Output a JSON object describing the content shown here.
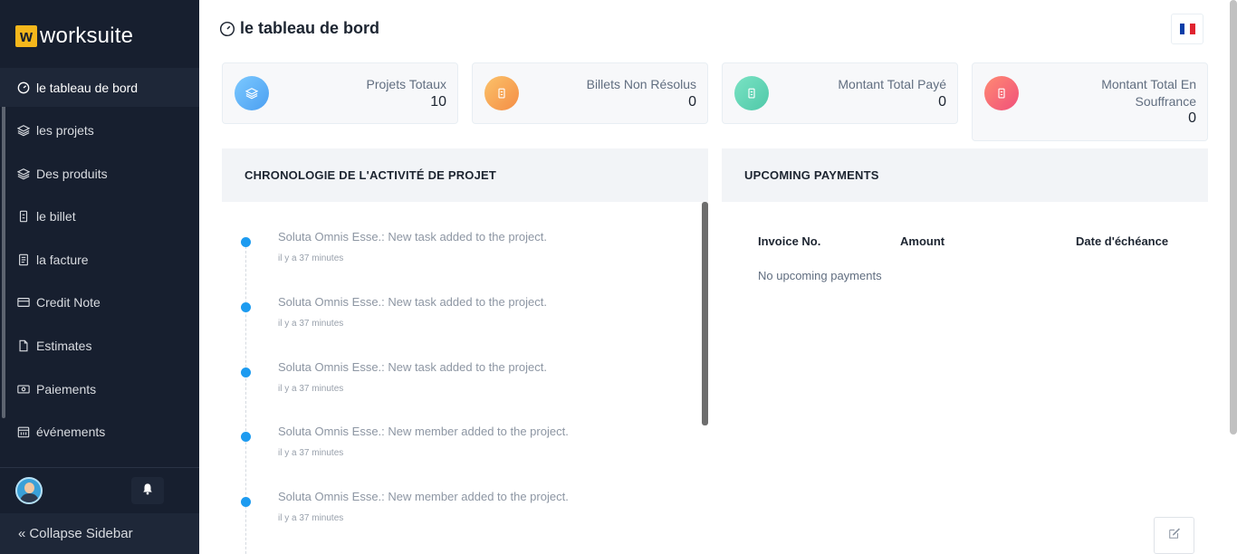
{
  "brand": {
    "logo_letter": "w",
    "name": "worksuite",
    "logo_color": "#f5b71c"
  },
  "sidebar": {
    "items": [
      {
        "label": "le tableau de bord",
        "icon": "dashboard-gauge-icon",
        "active": true
      },
      {
        "label": "les projets",
        "icon": "layers-icon"
      },
      {
        "label": "Des produits",
        "icon": "layers-icon"
      },
      {
        "label": "le billet",
        "icon": "ticket-icon"
      },
      {
        "label": "la facture",
        "icon": "invoice-icon"
      },
      {
        "label": "Credit Note",
        "icon": "credit-card-icon"
      },
      {
        "label": "Estimates",
        "icon": "file-icon"
      },
      {
        "label": "Paiements",
        "icon": "money-icon"
      },
      {
        "label": "événements",
        "icon": "calendar-icon"
      }
    ],
    "collapse_label": "Collapse Sidebar",
    "bg_color": "#171f2f"
  },
  "header": {
    "title": "le tableau de bord",
    "language_flag": "fr-flag-icon"
  },
  "stats": [
    {
      "label": "Projets Totaux",
      "value": "10",
      "icon": "layers-icon",
      "color": "#4fb3f5"
    },
    {
      "label": "Billets Non Résolus",
      "value": "0",
      "icon": "ticket-icon",
      "color": "#f7a74a"
    },
    {
      "label": "Montant Total Payé",
      "value": "0",
      "icon": "ticket-icon",
      "color": "#5fd6b6"
    },
    {
      "label": "Montant Total En Souffrance",
      "value": "0",
      "icon": "ticket-icon",
      "color": "#f66b6b"
    }
  ],
  "activity": {
    "title": "CHRONOLOGIE DE L'ACTIVITÉ DE PROJET",
    "items": [
      {
        "text": "Soluta Omnis Esse.: New task added to the project.",
        "time": "il y a 37 minutes"
      },
      {
        "text": "Soluta Omnis Esse.: New task added to the project.",
        "time": "il y a 37 minutes"
      },
      {
        "text": "Soluta Omnis Esse.: New task added to the project.",
        "time": "il y a 37 minutes"
      },
      {
        "text": "Soluta Omnis Esse.: New member added to the project.",
        "time": "il y a 37 minutes"
      },
      {
        "text": "Soluta Omnis Esse.: New member added to the project.",
        "time": "il y a 37 minutes"
      }
    ]
  },
  "payments": {
    "title": "UPCOMING PAYMENTS",
    "columns": [
      "Invoice No.",
      "Amount",
      "Date d'échéance"
    ],
    "empty_text": "No upcoming payments"
  }
}
